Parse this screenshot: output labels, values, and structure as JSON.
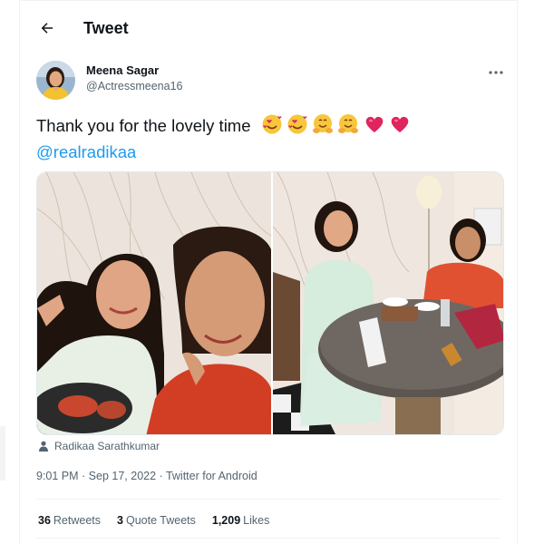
{
  "header": {
    "title": "Tweet"
  },
  "author": {
    "name": "Meena Sagar",
    "handle": "@Actressmeena16"
  },
  "tweet": {
    "text": "Thank you for the lovely time",
    "emojis": [
      "smiling-face-with-hearts",
      "smiling-face-with-hearts",
      "hugging-face",
      "hugging-face",
      "red-heart",
      "red-heart"
    ],
    "mention": "@realradikaa"
  },
  "media": {
    "tagged_user": "Radikaa Sarathkumar"
  },
  "meta": {
    "time": "9:01 PM",
    "separator1": " · ",
    "date": "Sep 17, 2022",
    "separator2": " · ",
    "source": "Twitter for Android"
  },
  "stats": {
    "retweets": {
      "count": "36",
      "label": "Retweets"
    },
    "quotes": {
      "count": "3",
      "label": "Quote Tweets"
    },
    "likes": {
      "count": "1,209",
      "label": "Likes"
    }
  },
  "colors": {
    "link": "#1d9bf0",
    "secondary_text": "#536471",
    "divider": "#eff3f4"
  }
}
